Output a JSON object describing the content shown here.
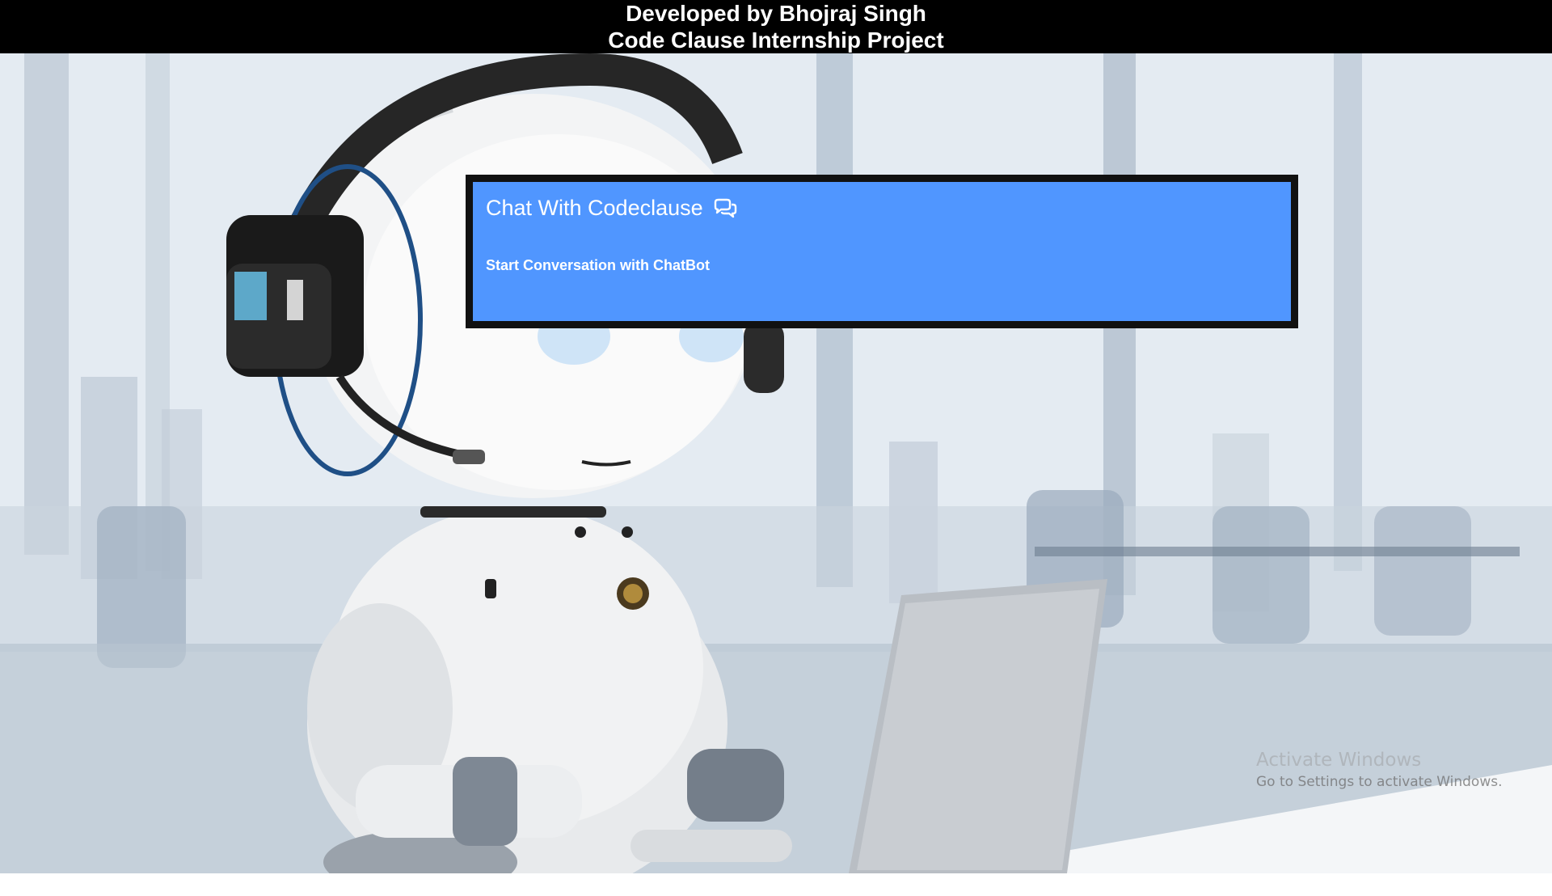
{
  "header": {
    "line1": "Developed by Bhojraj Singh",
    "line2": "Code Clause Internship Project"
  },
  "chat": {
    "title": "Chat With Codeclause",
    "title_icon": "comments-icon",
    "subtitle": "Start Conversation with ChatBot",
    "panel_color": "#5096ff",
    "border_color": "#111111"
  },
  "background": {
    "image": "robot-with-headset-at-laptop"
  },
  "watermark": {
    "title": "Activate Windows",
    "subtitle": "Go to Settings to activate Windows."
  }
}
